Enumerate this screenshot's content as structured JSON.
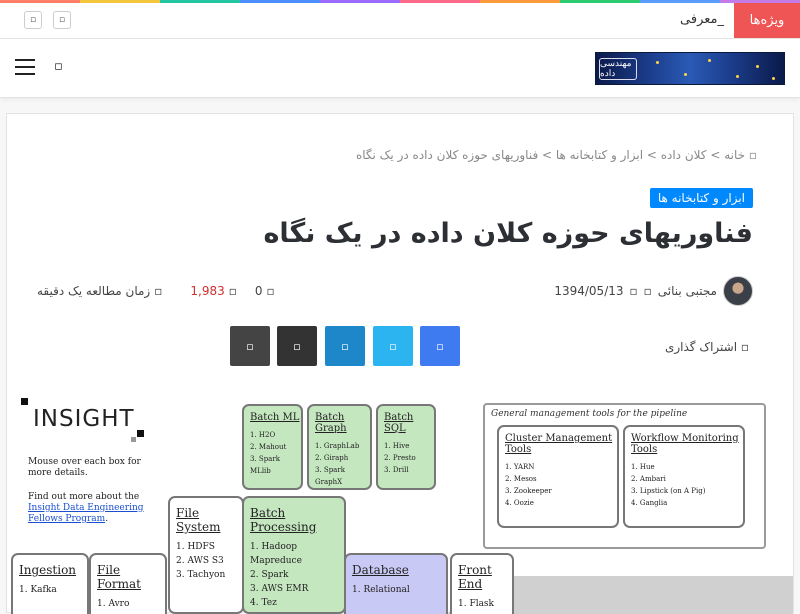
{
  "colors": {
    "rainbow": [
      "#ff7f66",
      "#f4c63d",
      "#23c6a0",
      "#4c8dff",
      "#9b6cff",
      "#ff6a88",
      "#ff9a3c",
      "#2ecc71",
      "#5b9cff",
      "#c47be8"
    ],
    "trend_bg": "#f05555",
    "badge_bg": "#0088ff",
    "share": [
      "#444444",
      "#333333",
      "#1e87c9",
      "#2cb4f0",
      "#3e7bf0"
    ]
  },
  "topbar": {
    "trending_label": "ویژه‌ها",
    "trending_text": "معرفی_",
    "social_icons": [
      "social-icon-1",
      "social-icon-2"
    ]
  },
  "header": {
    "logo_text": "مهندسی داده",
    "menu_icon": "hamburger-icon",
    "search_icon": "search-icon"
  },
  "breadcrumb": {
    "text": "خانه > کلان داده > ابزار و کتابخانه ها > فناوریهای حوزه کلان داده در یک نگاه",
    "home_icon": "home-icon"
  },
  "article": {
    "category": "ابزار و کتابخانه ها",
    "title": "فناوریهای حوزه کلان داده در یک نگاه",
    "author": "مجتبی بنائی",
    "date": "1394/05/13",
    "comments": "0",
    "views": "1,983",
    "reading_time": "زمان مطالعه یک دقیقه"
  },
  "share": {
    "label": "اشتراک گذاری",
    "buttons": [
      "print-icon",
      "email-icon",
      "linkedin-icon",
      "twitter-icon",
      "facebook-icon"
    ]
  },
  "diagram": {
    "insight": "INSIGHT",
    "intro_1": "Mouse over each box for more details.",
    "intro_2": "Find out more about the",
    "link": "Insight Data Engineering Fellows Program",
    "mgmt_title": "General management tools for the pipeline",
    "boxes": [
      {
        "title": "Batch ML",
        "items": [
          "1. H2O",
          "2. Mahout",
          "3. Spark MLlib"
        ]
      },
      {
        "title": "Batch Graph",
        "items": [
          "1. GraphLab",
          "2. Giraph",
          "3. Spark GraphX"
        ]
      },
      {
        "title": "Batch SQL",
        "items": [
          "1. Hive",
          "2. Presto",
          "3. Drill"
        ]
      },
      {
        "title": "Cluster Management Tools",
        "items": [
          "1. YARN",
          "2. Mesos",
          "3. Zookeeper",
          "4. Oozie"
        ]
      },
      {
        "title": "Workflow Monitoring Tools",
        "items": [
          "1. Hue",
          "2. Ambari",
          "3. Lipstick (on A Pig)",
          "4. Ganglia"
        ]
      },
      {
        "title": "File System",
        "items": [
          "1. HDFS",
          "2. AWS S3",
          "3. Tachyon"
        ]
      },
      {
        "title": "Batch Processing",
        "items": [
          "1. Hadoop Mapreduce",
          "2. Spark",
          "3. AWS EMR",
          "4. Tez"
        ]
      },
      {
        "title": "Ingestion",
        "items": [
          "1. Kafka"
        ]
      },
      {
        "title": "File Format",
        "items": [
          "1. Avro"
        ]
      },
      {
        "title": "Database",
        "items": [
          "1. Relational"
        ]
      },
      {
        "title": "Front End",
        "items": [
          "1. Flask"
        ]
      }
    ]
  }
}
